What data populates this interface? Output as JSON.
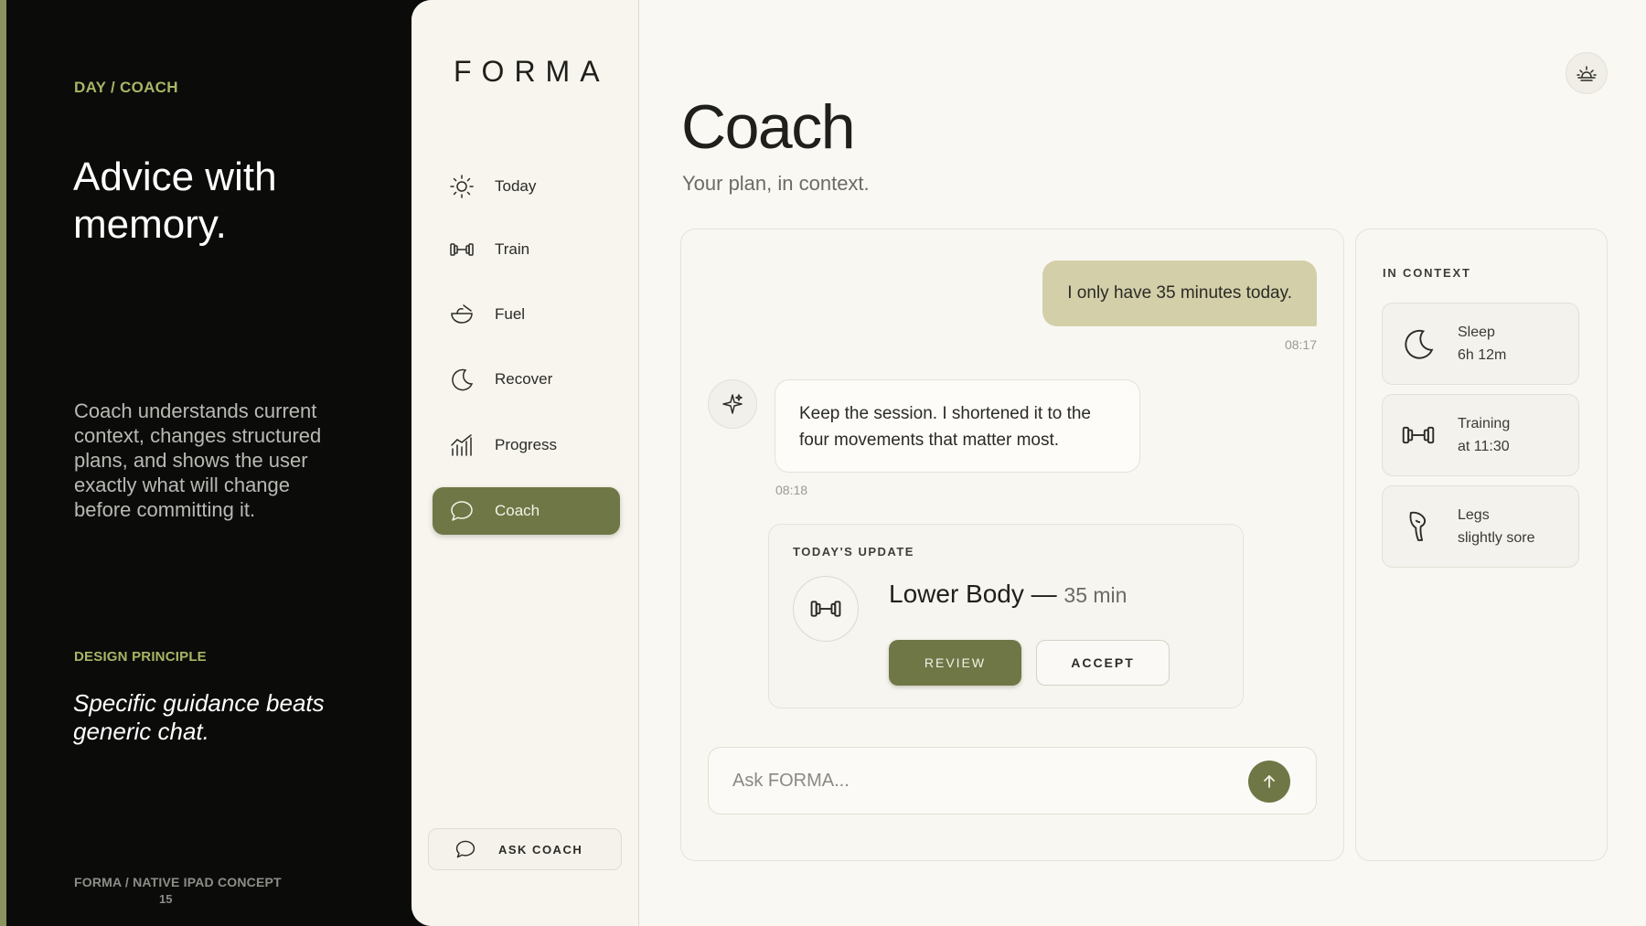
{
  "slide": {
    "breadcrumb": "DAY  /  COACH",
    "headline": "Advice with memory.",
    "description": "Coach understands current context, changes structured plans, and shows the user exactly what will change before committing it.",
    "principle_label": "DESIGN PRINCIPLE",
    "principle": "Specific guidance beats generic chat.",
    "footer": "FORMA  /  NATIVE IPAD CONCEPT",
    "page_number": "15"
  },
  "sidebar": {
    "logo": "FORMA",
    "items": [
      {
        "label": "Today",
        "icon": "sun-icon"
      },
      {
        "label": "Train",
        "icon": "dumbbell-icon"
      },
      {
        "label": "Fuel",
        "icon": "bowl-icon"
      },
      {
        "label": "Recover",
        "icon": "moon-icon"
      },
      {
        "label": "Progress",
        "icon": "chart-icon"
      },
      {
        "label": "Coach",
        "icon": "chat-bubble-icon",
        "active": true
      }
    ],
    "ask_coach": "ASK COACH"
  },
  "main": {
    "title": "Coach",
    "subtitle": "Your plan, in context.",
    "chat": {
      "user_message": "I only have 35 minutes today.",
      "user_time": "08:17",
      "coach_message": "Keep the session. I shortened it to the four movements that matter most.",
      "coach_time": "08:18",
      "update": {
        "label": "TODAY'S UPDATE",
        "title": "Lower Body —",
        "duration": "35 min",
        "review": "REVIEW",
        "accept": "ACCEPT"
      },
      "input_placeholder": "Ask FORMA..."
    },
    "context": {
      "label": "IN CONTEXT",
      "items": [
        {
          "line1": "Sleep",
          "line2": "6h 12m",
          "icon": "moon-icon"
        },
        {
          "line1": "Training",
          "line2": "at 11:30",
          "icon": "dumbbell-icon"
        },
        {
          "line1": "Legs",
          "line2": "slightly sore",
          "icon": "leg-icon"
        }
      ]
    }
  },
  "colors": {
    "accent": "#6f7746",
    "highlight": "#a9b565",
    "user_bubble": "#d3cfa9"
  }
}
